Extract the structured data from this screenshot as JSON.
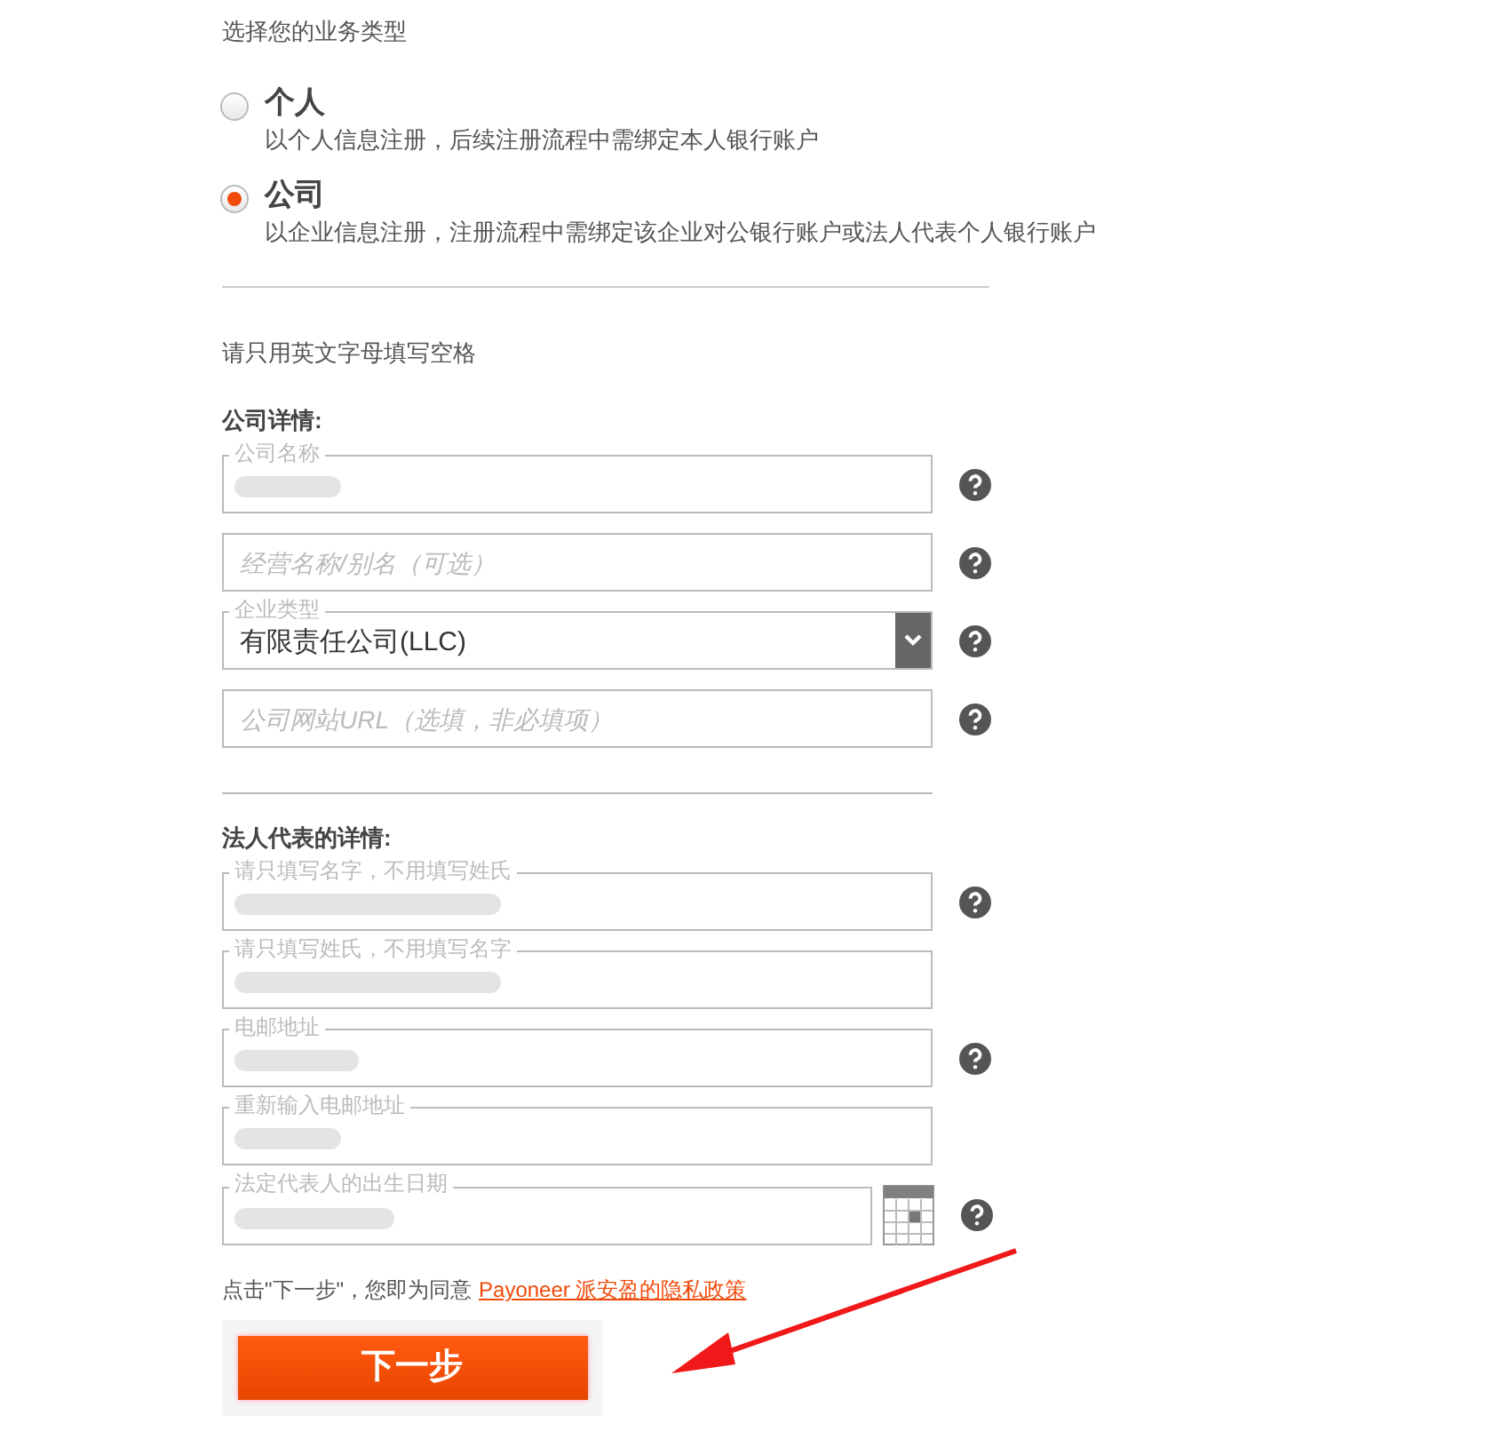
{
  "business_type": {
    "title": "选择您的业务类型",
    "options": [
      {
        "label": "个人",
        "description": "以个人信息注册，后续注册流程中需绑定本人银行账户",
        "selected": false
      },
      {
        "label": "公司",
        "description": "以企业信息注册，注册流程中需绑定该企业对公银行账户或法人代表个人银行账户",
        "selected": true
      }
    ]
  },
  "instruction": "请只用英文字母填写空格",
  "sections": [
    {
      "heading": "公司详情:",
      "fields": [
        {
          "kind": "text",
          "legend": "公司名称",
          "value_redacted": true,
          "help": true
        },
        {
          "kind": "text",
          "placeholder": "经营名称/别名（可选）",
          "value_redacted": false,
          "help": true
        },
        {
          "kind": "select",
          "legend": "企业类型",
          "value": "有限责任公司(LLC)",
          "help": true
        },
        {
          "kind": "text",
          "placeholder": "公司网站URL（选填，非必填项）",
          "value_redacted": false,
          "help": true
        }
      ]
    },
    {
      "heading": "法人代表的详情:",
      "fields": [
        {
          "kind": "text",
          "legend": "请只填写名字，不用填写姓氏",
          "value_redacted": true,
          "help": true
        },
        {
          "kind": "text",
          "legend": "请只填写姓氏，不用填写名字",
          "value_redacted": true,
          "help": false
        },
        {
          "kind": "text",
          "legend": "电邮地址",
          "value_redacted": true,
          "help": true
        },
        {
          "kind": "text",
          "legend": "重新输入电邮地址",
          "value_redacted": true,
          "help": false
        },
        {
          "kind": "date",
          "legend": "法定代表人的出生日期",
          "value_redacted": true,
          "help": true
        }
      ]
    }
  ],
  "consent": {
    "text": "点击\"下一步\"，您即为同意",
    "link": "Payoneer 派安盈的隐私政策"
  },
  "next_button": "下一步"
}
